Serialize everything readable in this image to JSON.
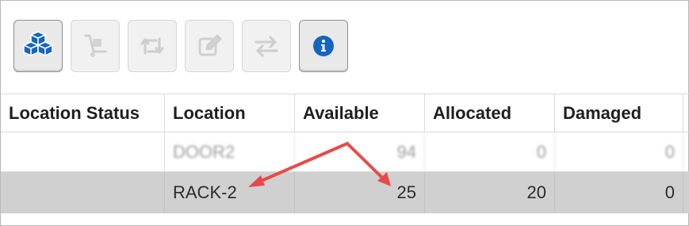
{
  "toolbar": {
    "buttons": [
      {
        "icon": "boxes-icon",
        "state": "active",
        "color": "#1565c0"
      },
      {
        "icon": "hand-truck-icon",
        "state": "disabled"
      },
      {
        "icon": "transfer-loop-icon",
        "state": "disabled"
      },
      {
        "icon": "edit-icon",
        "state": "disabled"
      },
      {
        "icon": "swap-arrows-icon",
        "state": "disabled"
      },
      {
        "icon": "info-icon",
        "state": "active",
        "color": "#1565c0"
      }
    ]
  },
  "grid": {
    "columns": [
      "Location Status",
      "Location",
      "Available",
      "Allocated",
      "Damaged"
    ],
    "rows": [
      {
        "location_status": "",
        "location": "DOOR2",
        "available": "94",
        "allocated": "0",
        "damaged": "0",
        "blurred": true
      },
      {
        "location_status": "",
        "location": "RACK-2",
        "available": "25",
        "allocated": "20",
        "damaged": "0",
        "selected": true
      }
    ]
  },
  "annotation": {
    "arrow_color": "#e84a4a",
    "targets": [
      "location",
      "available"
    ]
  }
}
